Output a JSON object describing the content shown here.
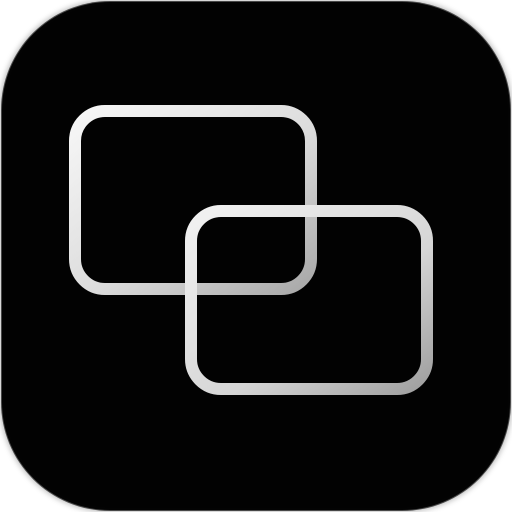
{
  "icon": {
    "name": "overlapping-windows-icon",
    "background_color": "#020202",
    "stroke_color_light": "#f6f6f6",
    "stroke_color_mid": "#d8d8d8",
    "stroke_color_dark": "#9a9a9a"
  }
}
